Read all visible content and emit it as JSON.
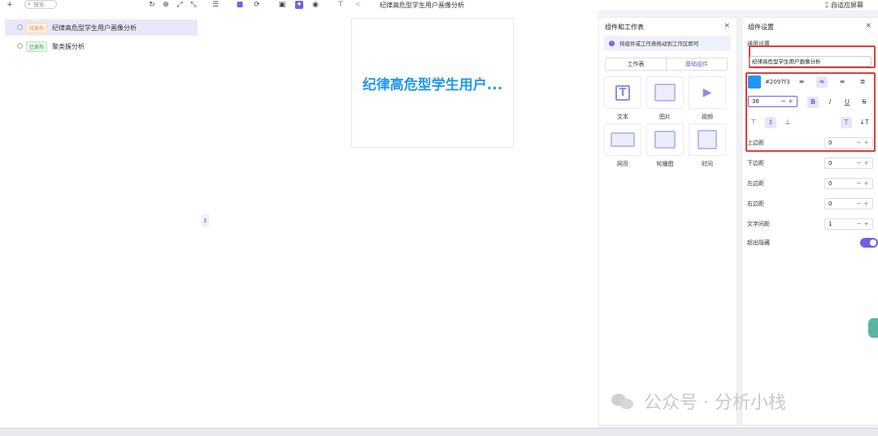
{
  "toolbar": {
    "search_placeholder": "搜索",
    "title": "纪律高危型学生用户画像分析",
    "fit_screen": "自适应屏幕"
  },
  "list": {
    "items": [
      {
        "status": "待发布",
        "status_color": "#f08a24",
        "name": "纪律高危型学生用户画像分析",
        "active": true
      },
      {
        "status": "已发布",
        "status_color": "#2f9e57",
        "name": "聚类簇分析",
        "active": false
      }
    ]
  },
  "canvas": {
    "text": "纪律高危型学生用户...",
    "text_color": "#2097f3"
  },
  "components": {
    "title": "组件和工作表",
    "close": "×",
    "tip": "将组件或工作表拖动到工作区即可",
    "tabs": [
      "工作表",
      "基础组件"
    ],
    "items": [
      {
        "label": "文本",
        "icon": "text-component-icon"
      },
      {
        "label": "图片",
        "icon": "image-component-icon"
      },
      {
        "label": "视频",
        "icon": "video-component-icon"
      },
      {
        "label": "网页",
        "icon": "webpage-component-icon"
      },
      {
        "label": "轮播图",
        "icon": "carousel-component-icon"
      },
      {
        "label": "时间",
        "icon": "time-component-icon"
      }
    ]
  },
  "settings": {
    "title": "组件设置",
    "close": "×",
    "section": "通用设置",
    "text_value": "纪律高危型学生用户画像分析",
    "color_hex": "#2097f3",
    "font_size": "36",
    "spacing": [
      {
        "label": "上边距",
        "value": "0"
      },
      {
        "label": "下边距",
        "value": "0"
      },
      {
        "label": "左边距",
        "value": "0"
      },
      {
        "label": "右边距",
        "value": "0"
      },
      {
        "label": "文字间距",
        "value": "1"
      }
    ],
    "overflow_label": "超出隐藏",
    "overflow_on": true
  },
  "watermark": "公众号 · 分析小栈",
  "colors": {
    "accent": "#6b63e0",
    "highlight": "#e23b3b"
  }
}
